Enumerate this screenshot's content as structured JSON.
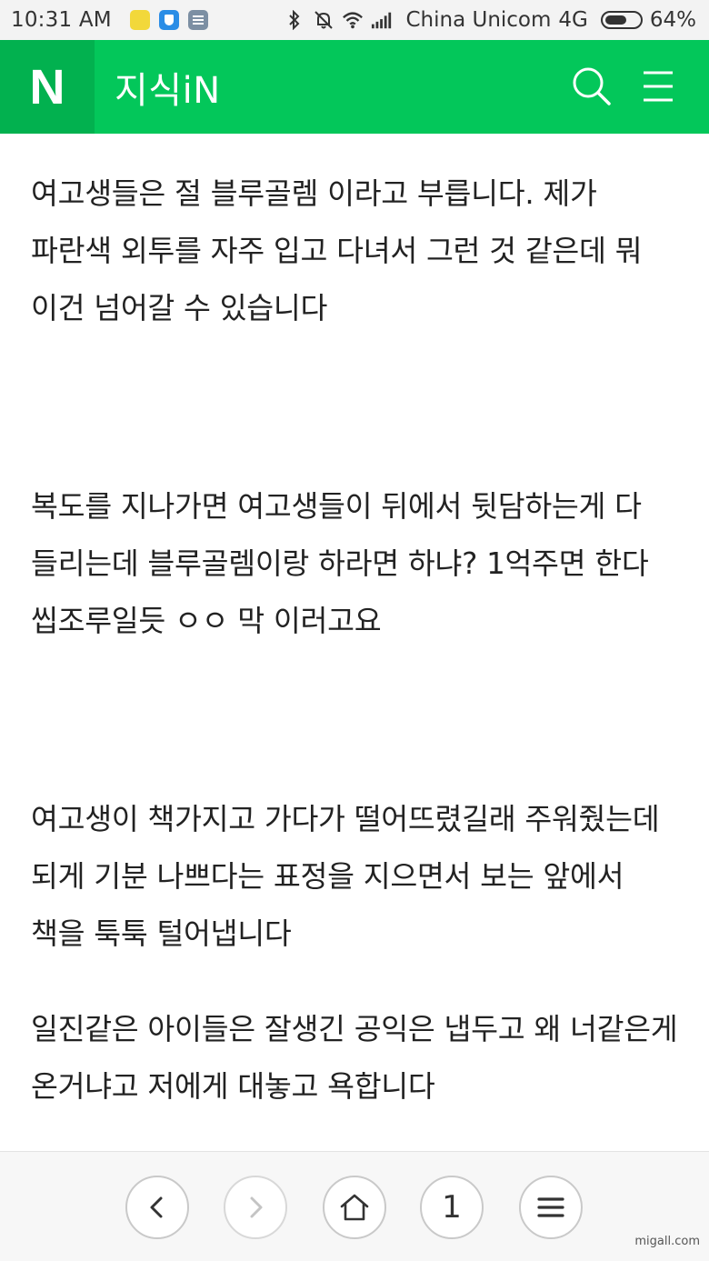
{
  "status_bar": {
    "time": "10:31",
    "ampm": "AM",
    "carrier": "China  Unicom",
    "network": "4G",
    "battery": "64%",
    "battery_level": 0.64,
    "icons": [
      "qq-music-icon",
      "shield-icon",
      "message-icon",
      "bluetooth-icon",
      "mute-icon",
      "wifi-icon",
      "signal-icon",
      "battery-icon"
    ]
  },
  "header": {
    "logo": "N",
    "title": "지식iN",
    "brand_color": "#03c75a",
    "icons": [
      "search-icon",
      "menu-icon"
    ]
  },
  "content": {
    "paragraphs": [
      "여고생들은 절 블루골렘 이라고 부릅니다. 제가 파란색 외투를 자주 입고 다녀서 그런 것 같은데 뭐 이건 넘어갈 수 있습니다",
      "복도를 지나가면 여고생들이 뒤에서 뒷담하는게 다 들리는데 블루골렘이랑 하라면 하냐? 1억주면 한다 씹조루일듯 ㅇㅇ 막 이러고요",
      "여고생이 책가지고 가다가 떨어뜨렸길래 주워줬는데 되게 기분 나쁘다는 표정을 지으면서 보는 앞에서 책을 툭툭 털어냅니다",
      "일진같은 아이들은 잘생긴 공익은 냅두고 왜 너같은게 온거냐고 저에게 대놓고 욕합니다"
    ]
  },
  "toolbar": {
    "tab_count": "1",
    "icons": [
      "back-icon",
      "forward-icon",
      "home-icon",
      "menu-icon"
    ]
  },
  "watermark": "migall.com"
}
